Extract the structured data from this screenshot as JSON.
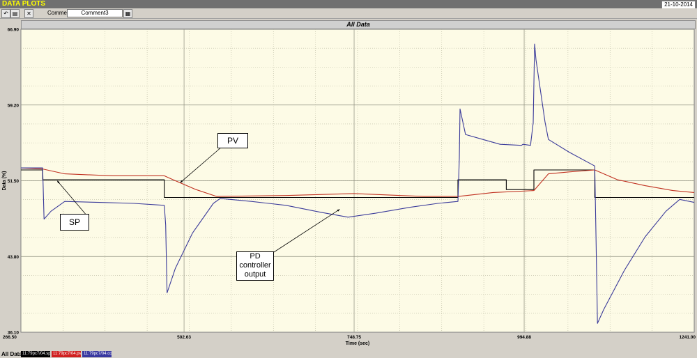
{
  "window": {
    "title": "DATA PLOTS",
    "date": "21-10-2014"
  },
  "toolbar": {
    "undo_icon": "undo-icon",
    "open_icon": "open-folder-icon",
    "close_icon": "close-icon",
    "comment_label": "Comment",
    "comment_value": "Comment3",
    "grid_icon": "grid-icon"
  },
  "statusbar": {
    "label": "All Data",
    "legend": [
      {
        "text": "11:79pc7/04.sp",
        "color": "#000000"
      },
      {
        "text": "11:79pc7/04.pv",
        "color": "#cc2020"
      },
      {
        "text": "11:79pc7/04.co",
        "color": "#3838a0"
      }
    ]
  },
  "chart_data": {
    "type": "line",
    "title": "All Data",
    "xlabel": "Time (sec)",
    "ylabel": "Data (%)",
    "xlim": [
      266.5,
      1241.0
    ],
    "ylim": [
      36.1,
      66.9
    ],
    "x_ticks": [
      "266.50",
      "502.63",
      "748.75",
      "994.88",
      "1241.00"
    ],
    "y_ticks": [
      "36.10",
      "43.80",
      "51.50",
      "59.20",
      "66.90"
    ],
    "grid": true,
    "colors": {
      "SP": "#000000",
      "PV": "#c03020",
      "CO": "#3a3a9a",
      "plot_bg": "#fdfbe6"
    },
    "series": [
      {
        "name": "SP",
        "color": "#000000",
        "points": [
          [
            266.5,
            52.6
          ],
          [
            298,
            52.6
          ],
          [
            298,
            51.6
          ],
          [
            474,
            51.6
          ],
          [
            474,
            49.8
          ],
          [
            899,
            49.8
          ],
          [
            899,
            51.6
          ],
          [
            969,
            51.6
          ],
          [
            969,
            50.6
          ],
          [
            1009,
            50.6
          ],
          [
            1009,
            52.6
          ],
          [
            1097,
            52.6
          ],
          [
            1097,
            49.8
          ],
          [
            1241,
            49.8
          ]
        ]
      },
      {
        "name": "PV",
        "color": "#c03020",
        "points": [
          [
            266.5,
            52.8
          ],
          [
            298,
            52.7
          ],
          [
            330,
            52.2
          ],
          [
            400,
            52.0
          ],
          [
            474,
            52.0
          ],
          [
            490,
            51.5
          ],
          [
            520,
            50.6
          ],
          [
            550,
            49.9
          ],
          [
            650,
            50.0
          ],
          [
            748,
            50.2
          ],
          [
            850,
            49.9
          ],
          [
            899,
            49.9
          ],
          [
            950,
            50.3
          ],
          [
            1009,
            50.5
          ],
          [
            1030,
            52.2
          ],
          [
            1060,
            52.4
          ],
          [
            1097,
            52.6
          ],
          [
            1130,
            51.6
          ],
          [
            1170,
            51.0
          ],
          [
            1210,
            50.5
          ],
          [
            1241,
            50.3
          ]
        ]
      },
      {
        "name": "CO",
        "color": "#3a3a9a",
        "points": [
          [
            266.5,
            52.8
          ],
          [
            298,
            52.8
          ],
          [
            300,
            47.6
          ],
          [
            310,
            48.4
          ],
          [
            330,
            49.4
          ],
          [
            380,
            49.3
          ],
          [
            430,
            49.2
          ],
          [
            474,
            49.0
          ],
          [
            476,
            47.0
          ],
          [
            478,
            40.1
          ],
          [
            490,
            42.6
          ],
          [
            515,
            46.2
          ],
          [
            545,
            49.2
          ],
          [
            555,
            49.7
          ],
          [
            600,
            49.4
          ],
          [
            650,
            49.0
          ],
          [
            700,
            48.3
          ],
          [
            740,
            47.8
          ],
          [
            780,
            48.2
          ],
          [
            830,
            48.8
          ],
          [
            870,
            49.2
          ],
          [
            899,
            49.4
          ],
          [
            901,
            53.8
          ],
          [
            902,
            58.8
          ],
          [
            910,
            56.2
          ],
          [
            935,
            55.7
          ],
          [
            960,
            55.2
          ],
          [
            991,
            55.1
          ],
          [
            993,
            55.2
          ],
          [
            1004,
            55.1
          ],
          [
            1008,
            57.4
          ],
          [
            1010,
            65.4
          ],
          [
            1012,
            63.8
          ],
          [
            1025,
            57.5
          ],
          [
            1030,
            55.7
          ],
          [
            1060,
            54.4
          ],
          [
            1097,
            53.0
          ],
          [
            1099,
            45.4
          ],
          [
            1101,
            37.0
          ],
          [
            1110,
            38.4
          ],
          [
            1140,
            42.4
          ],
          [
            1170,
            45.8
          ],
          [
            1200,
            48.4
          ],
          [
            1220,
            49.6
          ],
          [
            1241,
            49.3
          ]
        ]
      }
    ],
    "annotations": [
      "PV",
      "SP",
      "PD\ncontroller\noutput"
    ]
  }
}
